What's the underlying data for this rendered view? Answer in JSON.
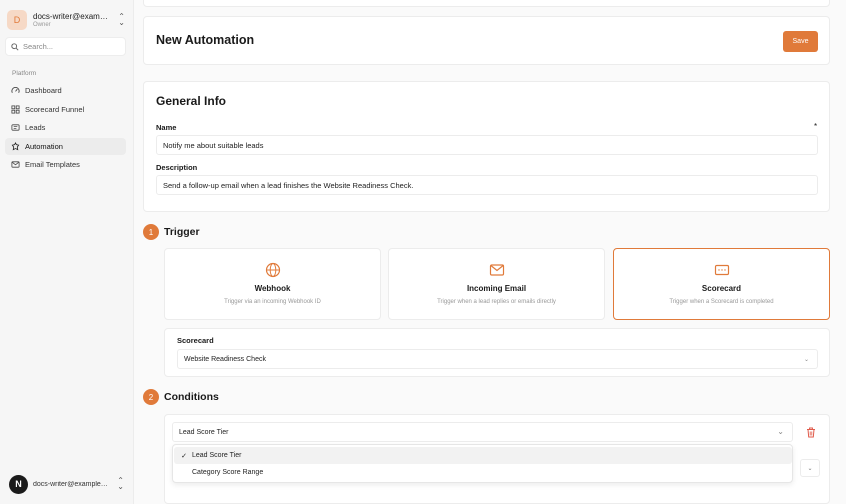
{
  "account": {
    "initial": "D",
    "email": "docs-writer@example.com",
    "role": "Owner"
  },
  "search": {
    "placeholder": "Search..."
  },
  "sidebar": {
    "section_label": "Platform",
    "items": [
      {
        "label": "Dashboard",
        "icon": "gauge-icon",
        "active": false
      },
      {
        "label": "Scorecard Funnel",
        "icon": "funnel-icon",
        "active": false
      },
      {
        "label": "Leads",
        "icon": "leads-icon",
        "active": false
      },
      {
        "label": "Automation",
        "icon": "automation-icon",
        "active": true
      },
      {
        "label": "Email Templates",
        "icon": "mail-icon",
        "active": false
      }
    ]
  },
  "user": {
    "initial": "N",
    "email": "docs-writer@example.com"
  },
  "header": {
    "title": "New Automation",
    "save_label": "Save"
  },
  "general": {
    "title": "General Info",
    "name_label": "Name",
    "required_mark": "*",
    "name_value": "Notify me about suitable leads",
    "description_label": "Description",
    "description_value": "Send a follow-up email when a lead finishes the Website Readiness Check."
  },
  "trigger": {
    "step": "1",
    "title": "Trigger",
    "options": [
      {
        "title": "Webhook",
        "desc": "Trigger via an incoming Webhook ID",
        "icon": "globe-icon",
        "selected": false
      },
      {
        "title": "Incoming Email",
        "desc": "Trigger when a lead replies or emails directly",
        "icon": "mail-icon",
        "selected": false
      },
      {
        "title": "Scorecard",
        "desc": "Trigger when a Scorecard is completed",
        "icon": "scorecard-icon",
        "selected": true
      }
    ],
    "scorecard_label": "Scorecard",
    "scorecard_value": "Website Readiness Check"
  },
  "conditions": {
    "step": "2",
    "title": "Conditions",
    "select_value": "Lead Score Tier",
    "options": [
      {
        "label": "Lead Score Tier",
        "selected": true
      },
      {
        "label": "Category Score Range",
        "selected": false
      }
    ]
  },
  "colors": {
    "accent": "#e07a3a",
    "sidebar_bg": "#f6f6f6",
    "delete": "#e05a4a"
  }
}
